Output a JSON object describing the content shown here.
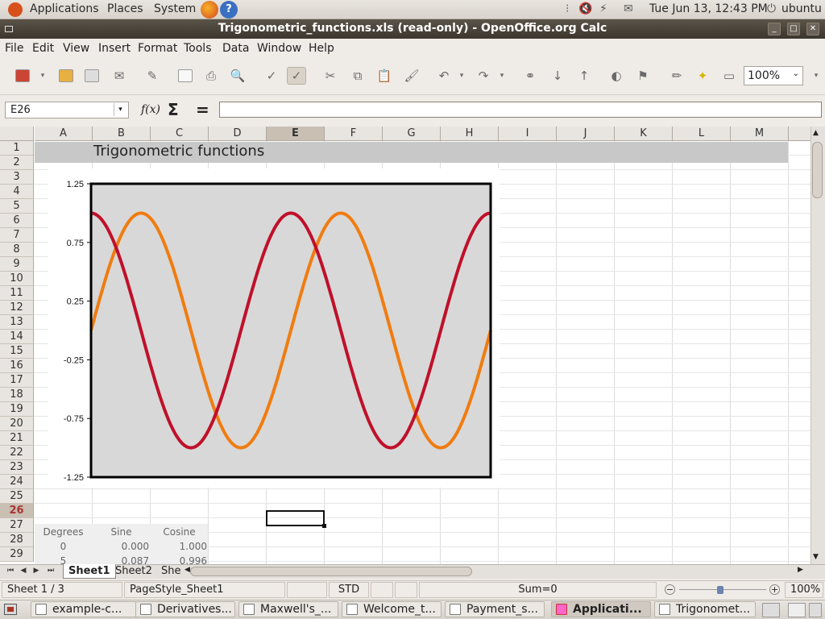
{
  "topbar": {
    "menus": [
      "Applications",
      "Places",
      "System"
    ],
    "clock": "Tue Jun 13, 12:43 PM",
    "user": "ubuntu"
  },
  "window": {
    "title": "Trigonometric_functions.xls (read-only) - OpenOffice.org Calc"
  },
  "menubar": [
    "File",
    "Edit",
    "View",
    "Insert",
    "Format",
    "Tools",
    "Data",
    "Window",
    "Help"
  ],
  "toolbar": {
    "zoom": "100%"
  },
  "formula": {
    "cell_ref": "E26",
    "value": ""
  },
  "sheet": {
    "columns": [
      "A",
      "B",
      "C",
      "D",
      "E",
      "F",
      "G",
      "H",
      "I",
      "J",
      "K",
      "L",
      "M"
    ],
    "selected_column": "E",
    "rows": [
      "1",
      "2",
      "3",
      "4",
      "5",
      "6",
      "7",
      "8",
      "9",
      "10",
      "11",
      "12",
      "13",
      "14",
      "15",
      "16",
      "17",
      "18",
      "19",
      "20",
      "21",
      "22",
      "23",
      "24",
      "25",
      "26",
      "27",
      "28",
      "29"
    ],
    "selected_row": "26",
    "title": "Trigonometric functions",
    "table_headers": [
      "Degrees",
      "Sine",
      "Cosine"
    ],
    "table_rows": [
      [
        "0",
        "0.000",
        "1.000"
      ],
      [
        "5",
        "0.087",
        "0.996"
      ]
    ]
  },
  "chart_data": {
    "type": "line",
    "title": "",
    "xlabel": "",
    "ylabel": "",
    "ylim": [
      -1.25,
      1.25
    ],
    "yticks": [
      "1.25",
      "0.75",
      "0.25",
      "-0.25",
      "-0.75",
      "-1.25"
    ],
    "x_range_degrees": [
      0,
      720
    ],
    "grid": false,
    "series": [
      {
        "color": "#f07c10",
        "function": "sin"
      },
      {
        "color": "#c0102a",
        "function": "cos"
      }
    ]
  },
  "sheet_tabs": [
    "Sheet1",
    "Sheet2",
    "She"
  ],
  "active_tab": "Sheet1",
  "statusbar": {
    "sheet": "Sheet 1 / 3",
    "page_style": "PageStyle_Sheet1",
    "mode": "STD",
    "sum": "Sum=0",
    "zoom": "100%"
  },
  "taskbar": [
    "example-c...",
    "Derivatives...",
    "Maxwell's_...",
    "Welcome_t...",
    "Payment_s...",
    "Applicati...",
    "Trigonomet..."
  ],
  "active_task": "Applicati..."
}
